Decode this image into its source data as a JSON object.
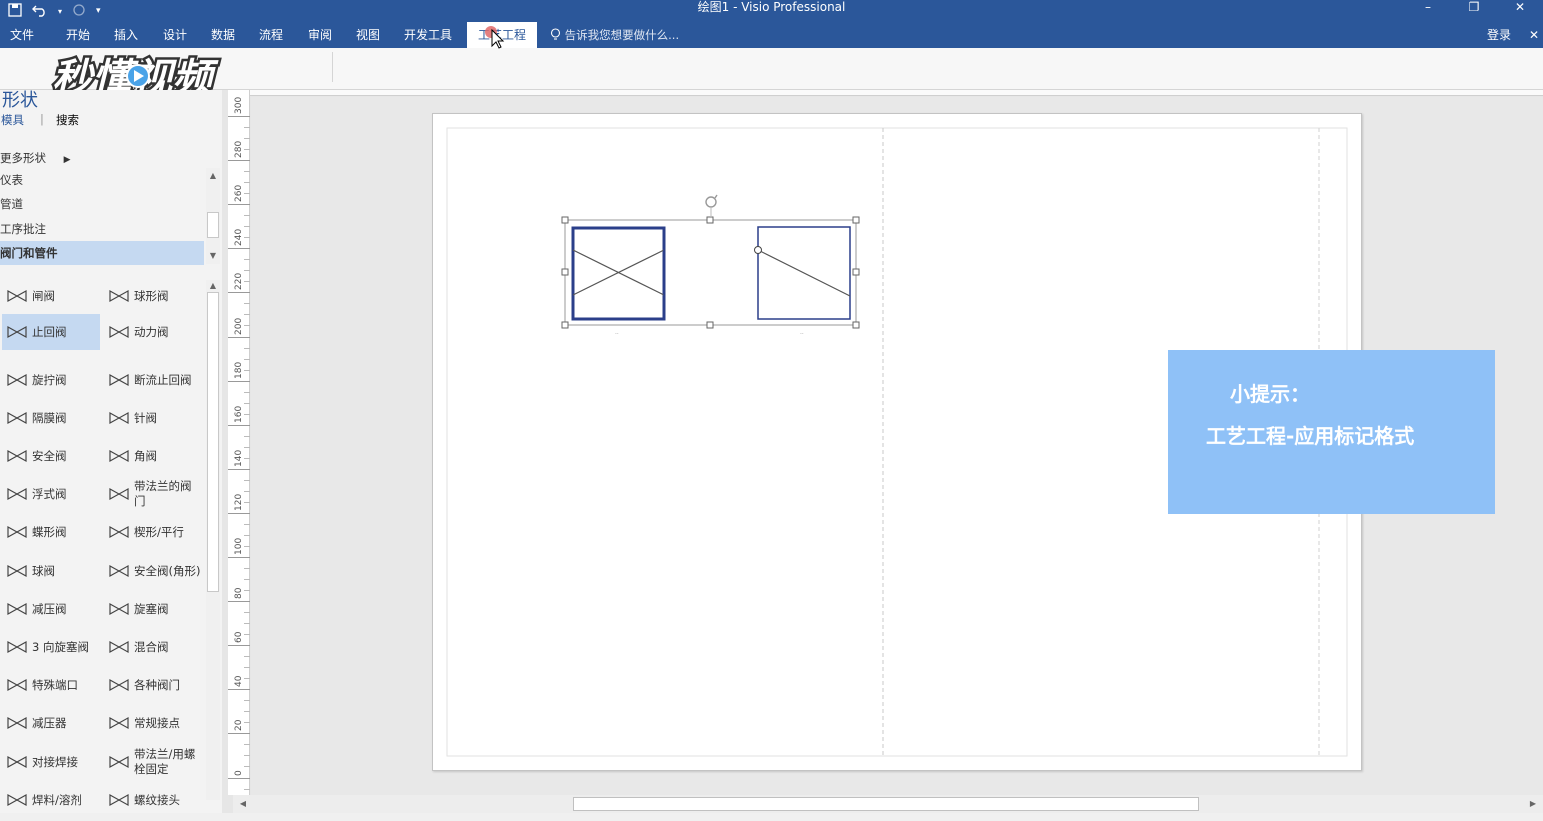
{
  "window": {
    "title": "绘图1 - Visio Professional",
    "minimize": "–",
    "restore": "❐",
    "close": "✕"
  },
  "ribbon": {
    "tabs": [
      {
        "label": "文件"
      },
      {
        "label": "开始"
      },
      {
        "label": "插入"
      },
      {
        "label": "设计"
      },
      {
        "label": "数据"
      },
      {
        "label": "流程"
      },
      {
        "label": "审阅"
      },
      {
        "label": "视图"
      },
      {
        "label": "开发工具"
      },
      {
        "label": "工艺工程"
      }
    ],
    "active_tab": "工艺工程",
    "tell_me": "告诉我您想要做什么...",
    "login": "登录"
  },
  "watermark": {
    "text": "秒懂视频"
  },
  "shapes_pane": {
    "title": "形状",
    "subtabs": {
      "stencils": "模具",
      "search": "搜索"
    },
    "more_shapes": "更多形状",
    "stencils": [
      {
        "label": "仪表"
      },
      {
        "label": "管道"
      },
      {
        "label": "工序批注"
      },
      {
        "label": "阀门和管件"
      }
    ],
    "active_stencil": "阀门和管件",
    "items": [
      {
        "label": "闸阀",
        "icon": "gate-valve-icon"
      },
      {
        "label": "球形阀",
        "icon": "globe-valve-icon"
      },
      {
        "label": "止回阀",
        "icon": "check-valve-icon",
        "selected": true
      },
      {
        "label": "动力阀",
        "icon": "power-valve-icon"
      },
      {
        "label": "旋拧阀",
        "icon": "screw-valve-icon"
      },
      {
        "label": "断流止回阀",
        "icon": "stop-check-valve-icon"
      },
      {
        "label": "隔膜阀",
        "icon": "diaphragm-valve-icon"
      },
      {
        "label": "针阀",
        "icon": "needle-valve-icon"
      },
      {
        "label": "安全阀",
        "icon": "safety-valve-icon"
      },
      {
        "label": "角阀",
        "icon": "angle-valve-icon"
      },
      {
        "label": "浮式阀",
        "icon": "float-valve-icon"
      },
      {
        "label": "带法兰的阀门",
        "icon": "flanged-valve-icon"
      },
      {
        "label": "蝶形阀",
        "icon": "butterfly-valve-icon"
      },
      {
        "label": "楔形/平行",
        "icon": "wedge-valve-icon"
      },
      {
        "label": "球阀",
        "icon": "ball-valve-icon"
      },
      {
        "label": "安全阀(角形)",
        "icon": "angle-safety-valve-icon"
      },
      {
        "label": "减压阀",
        "icon": "reducing-valve-icon"
      },
      {
        "label": "旋塞阀",
        "icon": "plug-valve-icon"
      },
      {
        "label": "3 向旋塞阀",
        "icon": "three-way-plug-valve-icon"
      },
      {
        "label": "混合阀",
        "icon": "mixing-valve-icon"
      },
      {
        "label": "特殊端口",
        "icon": "special-port-icon"
      },
      {
        "label": "各种阀门",
        "icon": "misc-valves-icon"
      },
      {
        "label": "减压器",
        "icon": "reducer-icon"
      },
      {
        "label": "常规接点",
        "icon": "junction-icon"
      },
      {
        "label": "对接焊接",
        "icon": "butt-weld-icon"
      },
      {
        "label": "带法兰/用螺栓固定",
        "icon": "flanged-bolted-icon"
      },
      {
        "label": "焊料/溶剂",
        "icon": "solder-icon"
      },
      {
        "label": "螺纹接头",
        "icon": "threaded-joint-icon"
      }
    ]
  },
  "ruler": {
    "vertical_labels": [
      "300",
      "280",
      "260",
      "240",
      "220",
      "200",
      "180",
      "160",
      "140",
      "120",
      "100",
      "80",
      "60",
      "40",
      "20",
      "0"
    ]
  },
  "tip": {
    "line1": "小提示：",
    "line2": "工艺工程-应用标记格式"
  },
  "colors": {
    "accent": "#2b579a",
    "selection": "#c5d9f1",
    "tip_bg": "#8fc1f7"
  }
}
